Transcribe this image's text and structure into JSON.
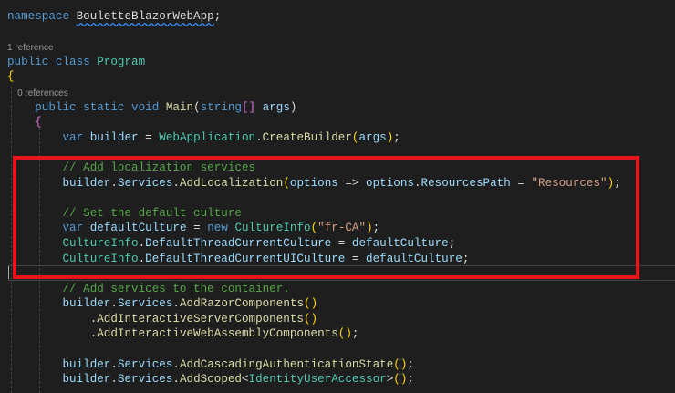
{
  "lines": [
    {
      "type": "code",
      "tokens": [
        [
          "kw",
          "namespace "
        ],
        [
          "pl squiggle",
          "BouletteBlazorWebApp"
        ],
        [
          "pl",
          ";"
        ]
      ]
    },
    {
      "type": "code",
      "tokens": []
    },
    {
      "type": "lens",
      "text": "1 reference"
    },
    {
      "type": "code",
      "tokens": [
        [
          "kw",
          "public class "
        ],
        [
          "ty",
          "Program"
        ]
      ]
    },
    {
      "type": "code",
      "tokens": [
        [
          "br1",
          "{"
        ]
      ]
    },
    {
      "type": "lens",
      "text": "    0 references"
    },
    {
      "type": "code",
      "tokens": [
        [
          "kw",
          "    public static void "
        ],
        [
          "me",
          "Main"
        ],
        [
          "pl",
          "("
        ],
        [
          "kw",
          "string"
        ],
        [
          "br2",
          "[]"
        ],
        [
          "va",
          " args"
        ],
        [
          "pl",
          ")"
        ]
      ]
    },
    {
      "type": "code",
      "tokens": [
        [
          "br2",
          "    {"
        ]
      ]
    },
    {
      "type": "code",
      "tokens": [
        [
          "kw",
          "        var "
        ],
        [
          "va",
          "builder"
        ],
        [
          "pl",
          " = "
        ],
        [
          "ty",
          "WebApplication"
        ],
        [
          "pl",
          "."
        ],
        [
          "me",
          "CreateBuilder"
        ],
        [
          "br1",
          "("
        ],
        [
          "va",
          "args"
        ],
        [
          "br1",
          ")"
        ],
        [
          "pl",
          ";"
        ]
      ]
    },
    {
      "type": "code",
      "tokens": []
    },
    {
      "type": "code",
      "tokens": [
        [
          "cm",
          "        // Add localization services"
        ]
      ]
    },
    {
      "type": "code",
      "tokens": [
        [
          "va",
          "        builder"
        ],
        [
          "pl",
          "."
        ],
        [
          "va",
          "Services"
        ],
        [
          "pl",
          "."
        ],
        [
          "me",
          "AddLocalization"
        ],
        [
          "br1",
          "("
        ],
        [
          "va",
          "options"
        ],
        [
          "pl",
          " => "
        ],
        [
          "va",
          "options"
        ],
        [
          "pl",
          "."
        ],
        [
          "va",
          "ResourcesPath"
        ],
        [
          "pl",
          " = "
        ],
        [
          "st",
          "\"Resources\""
        ],
        [
          "br1",
          ")"
        ],
        [
          "pl",
          ";"
        ]
      ]
    },
    {
      "type": "code",
      "tokens": []
    },
    {
      "type": "code",
      "tokens": [
        [
          "cm",
          "        // Set the default culture"
        ]
      ]
    },
    {
      "type": "code",
      "tokens": [
        [
          "kw",
          "        var "
        ],
        [
          "va",
          "defaultCulture"
        ],
        [
          "pl",
          " = "
        ],
        [
          "kw",
          "new "
        ],
        [
          "ty",
          "CultureInfo"
        ],
        [
          "br1",
          "("
        ],
        [
          "st",
          "\"fr-CA\""
        ],
        [
          "br1",
          ")"
        ],
        [
          "pl",
          ";"
        ]
      ]
    },
    {
      "type": "code",
      "tokens": [
        [
          "ty",
          "        CultureInfo"
        ],
        [
          "pl",
          "."
        ],
        [
          "va",
          "DefaultThreadCurrentCulture"
        ],
        [
          "pl",
          " = "
        ],
        [
          "va",
          "defaultCulture"
        ],
        [
          "pl",
          ";"
        ]
      ]
    },
    {
      "type": "code",
      "tokens": [
        [
          "ty",
          "        CultureInfo"
        ],
        [
          "pl",
          "."
        ],
        [
          "va",
          "DefaultThreadCurrentUICulture"
        ],
        [
          "pl",
          " = "
        ],
        [
          "va",
          "defaultCulture"
        ],
        [
          "pl",
          ";"
        ]
      ]
    },
    {
      "type": "code",
      "tokens": []
    },
    {
      "type": "code",
      "tokens": [
        [
          "cm",
          "        // Add services to the container."
        ]
      ]
    },
    {
      "type": "code",
      "tokens": [
        [
          "va",
          "        builder"
        ],
        [
          "pl",
          "."
        ],
        [
          "va",
          "Services"
        ],
        [
          "pl",
          "."
        ],
        [
          "me",
          "AddRazorComponents"
        ],
        [
          "br1",
          "()"
        ]
      ]
    },
    {
      "type": "code",
      "tokens": [
        [
          "pl",
          "            ."
        ],
        [
          "me",
          "AddInteractiveServerComponents"
        ],
        [
          "br1",
          "()"
        ]
      ]
    },
    {
      "type": "code",
      "tokens": [
        [
          "pl",
          "            ."
        ],
        [
          "me",
          "AddInteractiveWebAssemblyComponents"
        ],
        [
          "br1",
          "()"
        ],
        [
          "pl",
          ";"
        ]
      ]
    },
    {
      "type": "code",
      "tokens": []
    },
    {
      "type": "code",
      "tokens": [
        [
          "va",
          "        builder"
        ],
        [
          "pl",
          "."
        ],
        [
          "va",
          "Services"
        ],
        [
          "pl",
          "."
        ],
        [
          "me",
          "AddCascadingAuthenticationState"
        ],
        [
          "br1",
          "()"
        ],
        [
          "pl",
          ";"
        ]
      ]
    },
    {
      "type": "code",
      "tokens": [
        [
          "va",
          "        builder"
        ],
        [
          "pl",
          "."
        ],
        [
          "va",
          "Services"
        ],
        [
          "pl",
          "."
        ],
        [
          "me",
          "AddScoped"
        ],
        [
          "pl",
          "<"
        ],
        [
          "ty",
          "IdentityUserAccessor"
        ],
        [
          "pl",
          ">"
        ],
        [
          "br1",
          "()"
        ],
        [
          "pl",
          ";"
        ]
      ]
    }
  ]
}
